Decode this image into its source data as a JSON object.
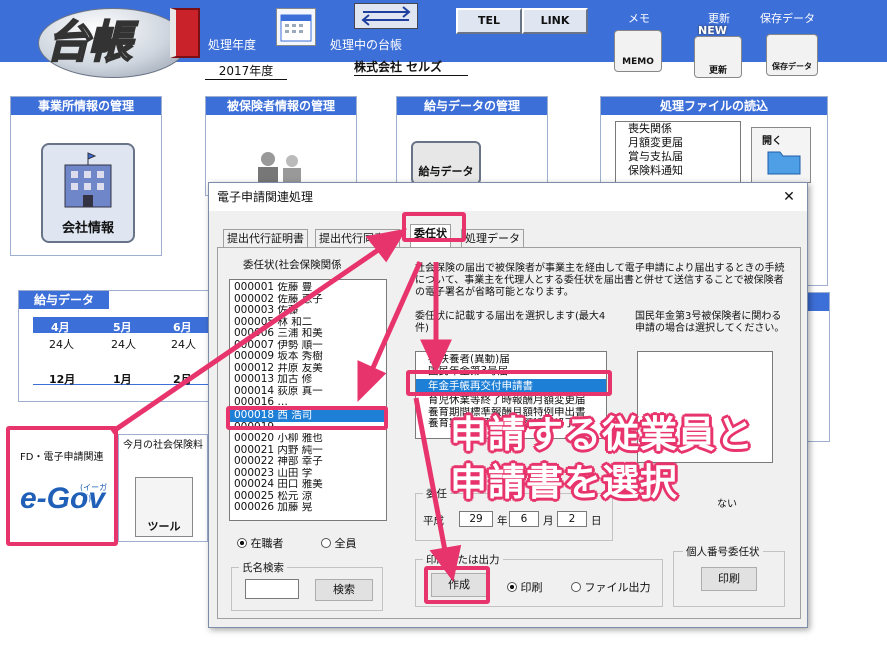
{
  "header": {
    "app_title": "台帳",
    "fiscal_year_label": "処理年度",
    "fiscal_year_value": "2017年度",
    "company_label": "処理中の台帳",
    "company_value": "株式会社 セルズ",
    "tel_button": "TEL",
    "link_button": "LINK",
    "memo_label": "メモ",
    "memo_icon_text": "MEMO",
    "update_label": "更新",
    "update_icon_text": "更新",
    "new_badge": "NEW",
    "save_label": "保存データ",
    "save_icon_text": "保存データ"
  },
  "panels": {
    "office": {
      "title": "事業所情報の管理",
      "icon_label": "会社情報"
    },
    "insured": {
      "title": "被保険者情報の管理"
    },
    "salary": {
      "title": "給与データの管理",
      "icon_label": "給与データ"
    },
    "files": {
      "title": "処理ファイルの読込",
      "items": [
        "喪失関係",
        "月額変更届",
        "賞与支払届",
        "保険料通知"
      ],
      "open_label": "開く"
    },
    "salary_data": {
      "title": "給与データ",
      "months_row1": [
        "4月",
        "5月",
        "6月"
      ],
      "counts_row1": [
        "24人",
        "24人",
        "24人"
      ],
      "months_row2": [
        "12月",
        "1月",
        "2月"
      ]
    },
    "fd": {
      "title": "FD・電子申請関連",
      "logo_main": "e-Gov",
      "logo_sub": "(イーガブ)"
    },
    "monthly": {
      "title": "今月の社会保険料",
      "tool_label": "ツール"
    }
  },
  "dialog": {
    "title": "電子申請関連処理",
    "close": "✕",
    "tabs": [
      "提出代行証明書",
      "提出代行同意書",
      "委任状",
      "処理データ"
    ],
    "employee_list_label": "委任状(社会保険関係",
    "employees": [
      "000001 佐藤 豊",
      "000002 佐藤 恵子",
      "000003 佐藤",
      "000005 林 和二",
      "000006 三浦 和美",
      "000007 伊勢 順一",
      "000009 坂本 秀樹",
      "000012 井原 友美",
      "000013 加古 修",
      "000014 荻原 真一",
      "000016 …",
      "000018 西 浩司",
      "000019 …",
      "000020 小柳 雅也",
      "000021 内野 純一",
      "000022 神部 幸子",
      "000023 山田 学",
      "000024 田口 雅美",
      "000025 松元 涼",
      "000026 加藤 晃"
    ],
    "selected_employee": "000018 西 浩司",
    "radio_active": "在職者",
    "radio_all": "全員",
    "name_search_label": "氏名検索",
    "name_search_value": "",
    "search_button": "検索",
    "description": "社会保険の届出で被保険者が事業主を経由して電子申請により届出するときの手続について、事業主を代理人とする委任状を届出書と併せて送信することで被保険者の電子署名が省略可能となります。",
    "form_select_label": "委任状に記載する届出を選択します(最大4件)",
    "forms": [
      "被扶養者(異動)届",
      "国民年金第3号届",
      "年金手帳再交付申請書",
      "育児休業等終了時報酬月額変更届",
      "養育期間標準報酬月額特例申出書",
      "養育期間標準報酬月額特例終了届"
    ],
    "selected_form": "年金手帳再交付申請書",
    "note_label": "国民年金第3号被保険者に関わる申請の場合は選択してください。",
    "date_group": "委任",
    "date_era": "平成",
    "date_year": "29",
    "date_year_unit": "年",
    "date_month": "6",
    "date_month_unit": "月",
    "date_day": "2",
    "date_day_unit": "日",
    "output_group": "印刷または出力",
    "create_button": "作成",
    "radio_print": "印刷",
    "radio_file": "ファイル出力",
    "mynumber_group": "個人番号委任状",
    "mynumber_print": "印刷",
    "hidden_text": "ない"
  },
  "annotation": {
    "line1": "申請する従業員と",
    "line2": "申請書を選択",
    "color": "#e8346c"
  }
}
